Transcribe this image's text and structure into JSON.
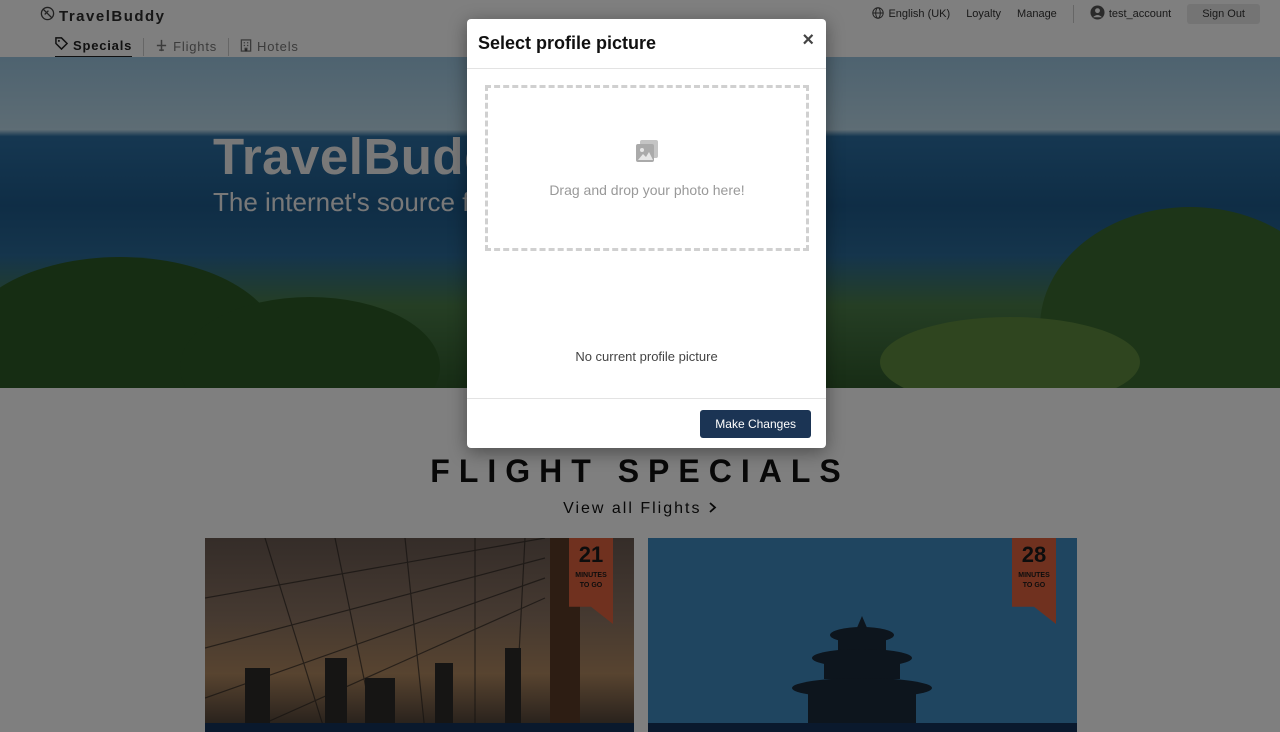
{
  "app": {
    "logo_text": "TravelBuddy",
    "nav_tabs": [
      {
        "label": "Specials",
        "icon": "tag-icon",
        "active": true
      },
      {
        "label": "Flights",
        "icon": "plane-icon",
        "active": false
      },
      {
        "label": "Hotels",
        "icon": "building-icon",
        "active": false
      }
    ],
    "language_label": "English (UK)",
    "loyalty_label": "Loyalty",
    "manage_label": "Manage",
    "account_label": "test_account",
    "signout_label": "Sign Out"
  },
  "hero": {
    "title": "TravelBuddy",
    "subtitle": "The internet's source for"
  },
  "specials": {
    "title": "FLIGHT SPECIALS",
    "view_all_label": "View all Flights",
    "cards": [
      {
        "minutes": "21",
        "minutes_label_line1": "MINUTES",
        "minutes_label_line2": "TO GO"
      },
      {
        "minutes": "28",
        "minutes_label_line1": "MINUTES",
        "minutes_label_line2": "TO GO"
      }
    ]
  },
  "modal": {
    "title": "Select profile picture",
    "close_label": "×",
    "drop_text": "Drag and drop your photo here!",
    "no_picture_text": "No current profile picture",
    "submit_label": "Make Changes"
  },
  "colors": {
    "primary_button": "#1b3454",
    "ribbon": "#e0623f",
    "card_bar": "#14335b"
  }
}
